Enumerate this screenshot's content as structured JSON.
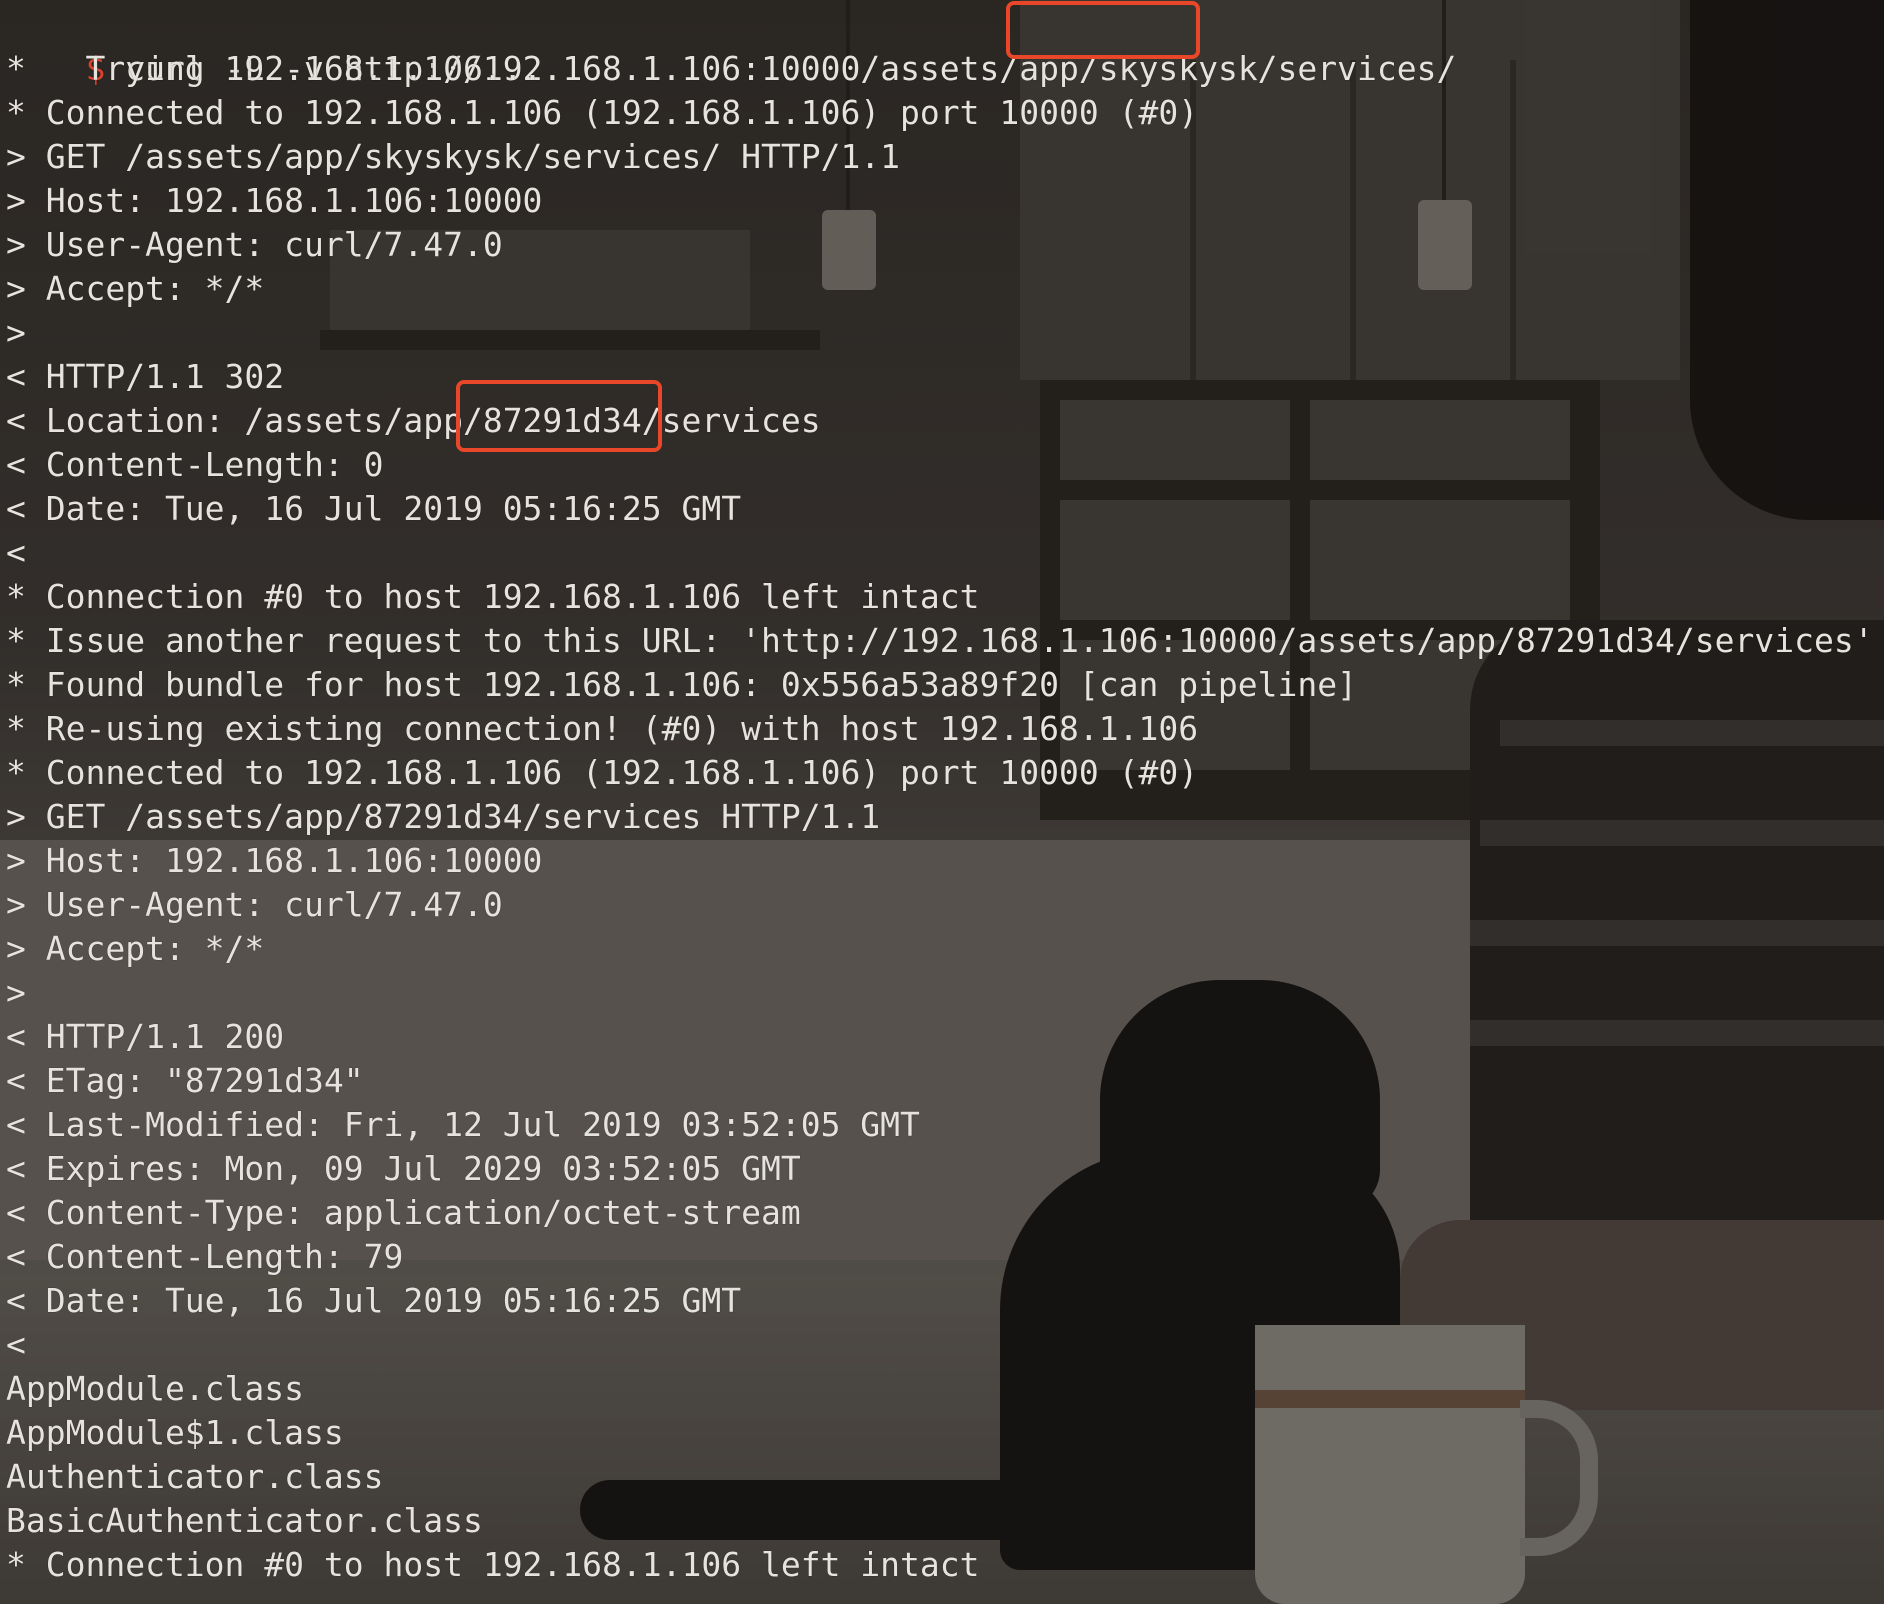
{
  "theme": {
    "prompt_color": "#d9412e",
    "highlight_color": "#e8472a",
    "text_color": "#e6e3de"
  },
  "terminal": {
    "prompt_symbol": "$",
    "command": " curl -L -v http://192.168.1.106:10000/assets/app/skyskysk/services/",
    "lines": [
      "*   Trying 192.168.1.106...",
      "* Connected to 192.168.1.106 (192.168.1.106) port 10000 (#0)",
      "> GET /assets/app/skyskysk/services/ HTTP/1.1",
      "> Host: 192.168.1.106:10000",
      "> User-Agent: curl/7.47.0",
      "> Accept: */*",
      ">",
      "< HTTP/1.1 302",
      "< Location: /assets/app/87291d34/services",
      "< Content-Length: 0",
      "< Date: Tue, 16 Jul 2019 05:16:25 GMT",
      "<",
      "* Connection #0 to host 192.168.1.106 left intact",
      "* Issue another request to this URL: 'http://192.168.1.106:10000/assets/app/87291d34/services'",
      "* Found bundle for host 192.168.1.106: 0x556a53a89f20 [can pipeline]",
      "* Re-using existing connection! (#0) with host 192.168.1.106",
      "* Connected to 192.168.1.106 (192.168.1.106) port 10000 (#0)",
      "> GET /assets/app/87291d34/services HTTP/1.1",
      "> Host: 192.168.1.106:10000",
      "> User-Agent: curl/7.47.0",
      "> Accept: */*",
      ">",
      "< HTTP/1.1 200",
      "< ETag: \"87291d34\"",
      "< Last-Modified: Fri, 12 Jul 2019 03:52:05 GMT",
      "< Expires: Mon, 09 Jul 2029 03:52:05 GMT",
      "< Content-Type: application/octet-stream",
      "< Content-Length: 79",
      "< Date: Tue, 16 Jul 2019 05:16:25 GMT",
      "<",
      "AppModule.class",
      "AppModule$1.class",
      "Authenticator.class",
      "BasicAuthenticator.class",
      "* Connection #0 to host 192.168.1.106 left intact"
    ]
  }
}
